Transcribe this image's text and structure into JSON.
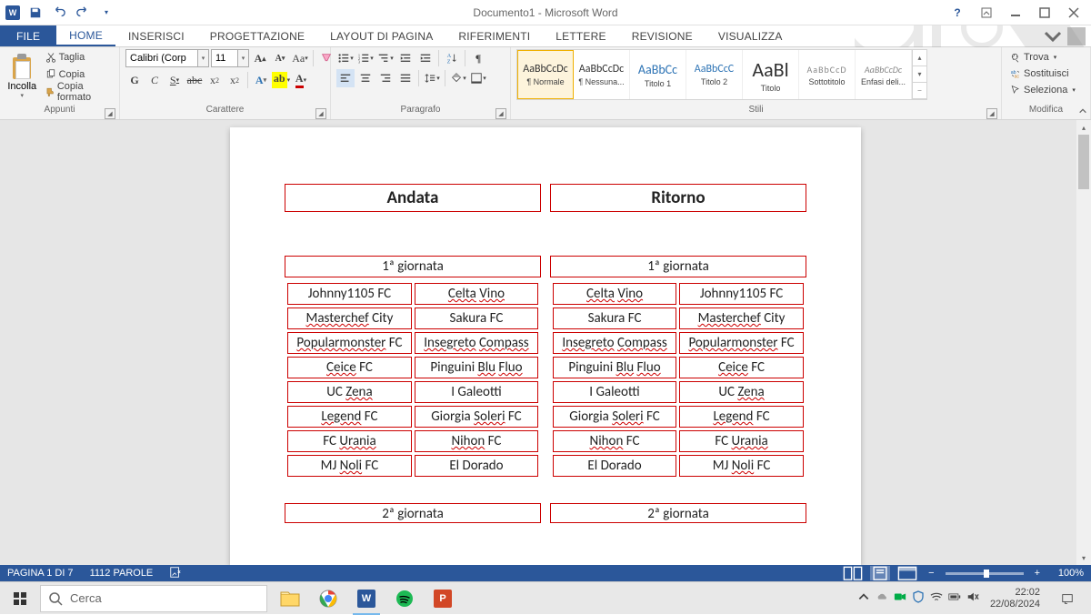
{
  "titlebar": {
    "doc_title": "Documento1 - Microsoft Word"
  },
  "tabs": {
    "file": "FILE",
    "items": [
      "HOME",
      "INSERISCI",
      "PROGETTAZIONE",
      "LAYOUT DI PAGINA",
      "RIFERIMENTI",
      "LETTERE",
      "REVISIONE",
      "VISUALIZZA"
    ],
    "active_index": 0
  },
  "ribbon": {
    "clipboard": {
      "paste": "Incolla",
      "cut": "Taglia",
      "copy": "Copia",
      "format_painter": "Copia formato",
      "group_label": "Appunti"
    },
    "font": {
      "family": "Calibri (Corp",
      "size": "11",
      "group_label": "Carattere"
    },
    "paragraph": {
      "group_label": "Paragrafo"
    },
    "styles": {
      "group_label": "Stili",
      "items": [
        {
          "preview": "AaBbCcDc",
          "name": "¶ Normale"
        },
        {
          "preview": "AaBbCcDc",
          "name": "¶ Nessuna..."
        },
        {
          "preview": "AaBbCc",
          "name": "Titolo 1"
        },
        {
          "preview": "AaBbCcC",
          "name": "Titolo 2"
        },
        {
          "preview": "AaBl",
          "name": "Titolo"
        },
        {
          "preview": "AaBbCcD",
          "name": "Sottotitolo"
        },
        {
          "preview": "AaBbCcDc",
          "name": "Enfasi deli..."
        }
      ]
    },
    "editing": {
      "find": "Trova",
      "replace": "Sostituisci",
      "select": "Seleziona",
      "group_label": "Modifica"
    }
  },
  "document": {
    "andata": "Andata",
    "ritorno": "Ritorno",
    "giornata1": "1ª giornata",
    "giornata2": "2ª giornata",
    "left_rows": [
      [
        "Johnny1105 FC",
        "Celta Vino"
      ],
      [
        "Masterchef City",
        "Sakura FC"
      ],
      [
        "Popularmonster FC",
        "Insegreto Compass"
      ],
      [
        "Ceice FC",
        "Pinguini Blu Fluo"
      ],
      [
        "UC Zena",
        "I Galeotti"
      ],
      [
        "Legend FC",
        "Giorgia Soleri FC"
      ],
      [
        "FC Urania",
        "Nihon FC"
      ],
      [
        "MJ Noli FC",
        "El Dorado"
      ]
    ],
    "right_rows": [
      [
        "Celta Vino",
        "Johnny1105 FC"
      ],
      [
        "Sakura FC",
        "Masterchef City"
      ],
      [
        "Insegreto Compass",
        "Popularmonster FC"
      ],
      [
        "Pinguini Blu Fluo",
        "Ceice FC"
      ],
      [
        "I Galeotti",
        "UC Zena"
      ],
      [
        "Giorgia Soleri FC",
        "Legend FC"
      ],
      [
        "Nihon FC",
        "FC Urania"
      ],
      [
        "El Dorado",
        "MJ Noli FC"
      ]
    ]
  },
  "statusbar": {
    "page": "PAGINA 1 DI 7",
    "words": "1112 PAROLE",
    "zoom": "100%"
  },
  "taskbar": {
    "search_placeholder": "Cerca",
    "time": "22:02",
    "date": "22/08/2024"
  }
}
